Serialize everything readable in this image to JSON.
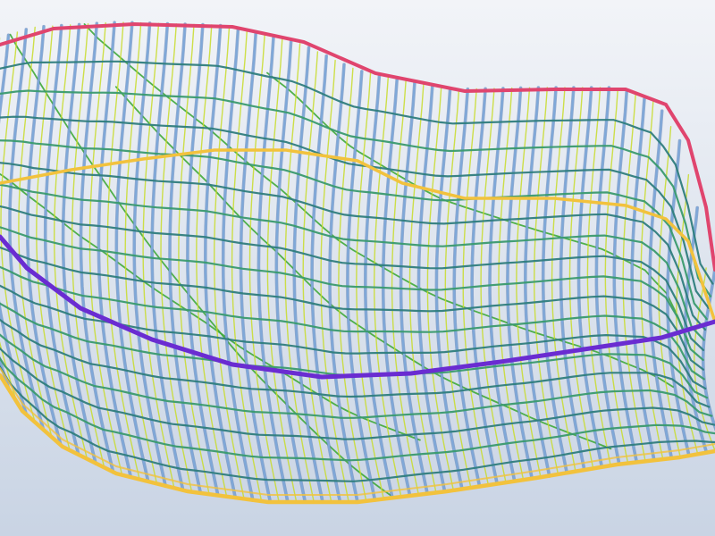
{
  "viewport": {
    "background_top": "#f2f4f8",
    "background_bottom": "#c9d4e4",
    "view_mode": "wireframe",
    "description_visible_text": []
  },
  "model": {
    "type": "freeform shell gridshell",
    "colors": {
      "vertical_members": "#7fa8d8",
      "vertical_members_shadow": "#4f74b0",
      "horizontal_members": "#2f7d7d",
      "horizontal_members_alt": "#3a9a6e",
      "secondary_members": "#c8dc2a",
      "diagonal_bracing": "#3faa3a",
      "edge_ring_top": "#e0456e",
      "edge_ring_bottom": "#f2c23d",
      "mid_ring": "#6a2cd1"
    },
    "grid": {
      "rings": 18,
      "ribs": 42
    }
  }
}
